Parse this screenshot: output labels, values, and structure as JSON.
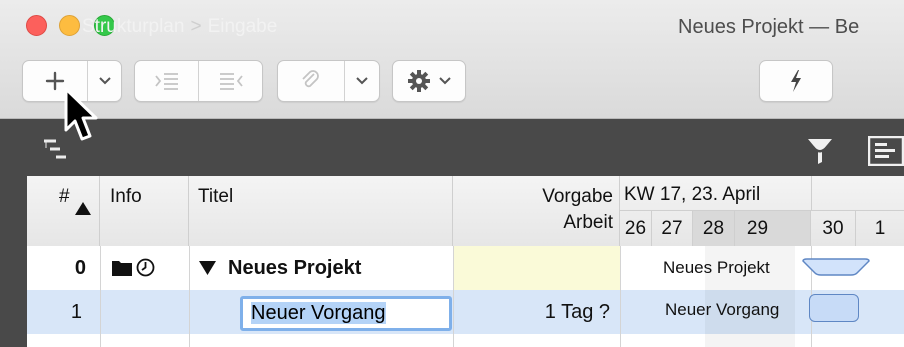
{
  "window": {
    "title": "Neues Projekt — Be"
  },
  "pathbar": {
    "crumb1": "Strukturplan",
    "separator": ">",
    "crumb2": "Eingabe"
  },
  "columns": {
    "num": "#",
    "info": "Info",
    "title": "Titel",
    "vorgabe": "Vorgabe",
    "arbeit": "Arbeit"
  },
  "gantt": {
    "week_label": "KW 17, 23. April",
    "days": [
      "26",
      "27",
      "28",
      "29",
      "30",
      "1"
    ]
  },
  "rows": [
    {
      "num": "0",
      "title": "Neues Projekt",
      "work": "",
      "bar_label": "Neues Projekt"
    },
    {
      "num": "1",
      "title": "Neuer Vorgang",
      "work": "1 Tag ?",
      "bar_label": "Neuer Vorgang"
    }
  ],
  "icons": {
    "toolbar": [
      "plus-icon",
      "chevron-down-icon",
      "indent-icon",
      "outdent-icon",
      "link-icon",
      "chevron-down-icon",
      "gear-icon",
      "chevron-down-icon",
      "lightning-icon"
    ],
    "pathbar": [
      "outline-icon",
      "filter-icon",
      "gantt-view-icon"
    ],
    "row0_info": [
      "folder-icon",
      "clock-icon"
    ],
    "sort": "sort-ascending-icon",
    "disclosure": "disclosure-triangle-icon"
  },
  "colors": {
    "selection_row": "#d8e6f8",
    "pathbar_bg": "#494949",
    "highlight_cell": "#fafad8",
    "edit_border": "#7fb0ea"
  }
}
